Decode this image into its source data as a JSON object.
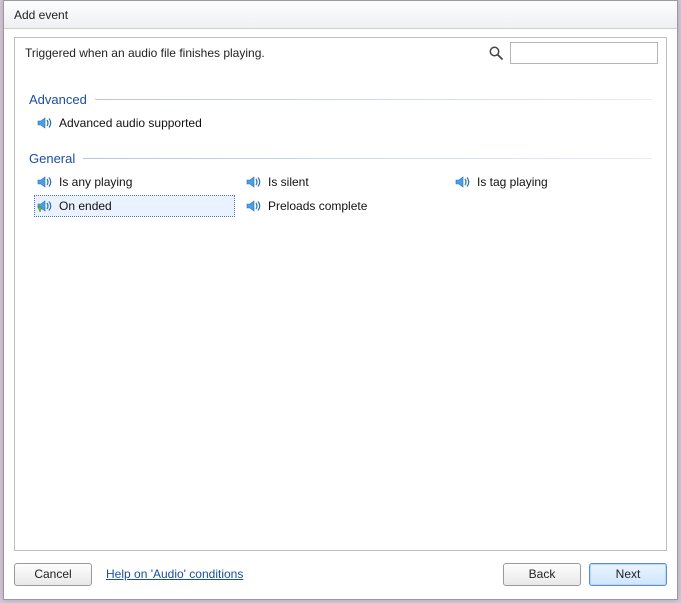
{
  "window": {
    "title": "Add event"
  },
  "description": "Triggered when an audio file finishes playing.",
  "search": {
    "placeholder": "",
    "value": ""
  },
  "groups": [
    {
      "name": "Advanced",
      "items": [
        {
          "label": "Advanced audio supported",
          "selected": false
        }
      ]
    },
    {
      "name": "General",
      "items": [
        {
          "label": "Is any playing",
          "selected": false
        },
        {
          "label": "Is silent",
          "selected": false
        },
        {
          "label": "Is tag playing",
          "selected": false
        },
        {
          "label": "On ended",
          "selected": true
        },
        {
          "label": "Preloads complete",
          "selected": false
        }
      ]
    }
  ],
  "footer": {
    "cancel": "Cancel",
    "help": "Help on 'Audio' conditions",
    "back": "Back",
    "next": "Next"
  }
}
